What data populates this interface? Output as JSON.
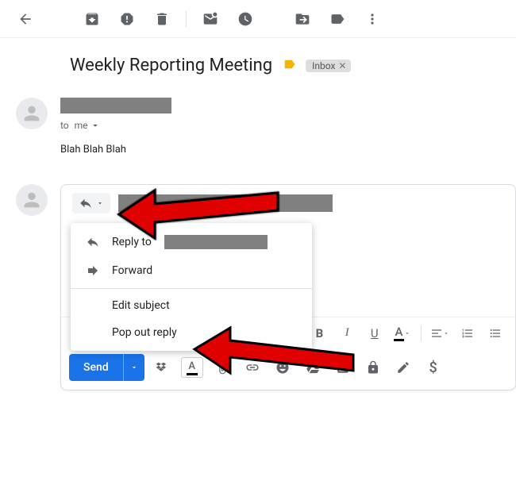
{
  "toolbar": {
    "icons": [
      "back",
      "archive",
      "spam",
      "delete",
      "unread",
      "snooze",
      "move",
      "label",
      "more"
    ]
  },
  "email": {
    "subject": "Weekly Reporting Meeting",
    "label_chip": "Inbox",
    "to_prefix": "to",
    "to_value": "me",
    "body_text": "Blah Blah Blah"
  },
  "reply": {
    "button_hint": "Reply",
    "menu": {
      "reply_to": "Reply to",
      "forward": "Forward",
      "edit_subject": "Edit subject",
      "pop_out": "Pop out reply"
    }
  },
  "format": {
    "bold": "B",
    "italic": "I",
    "underline": "U",
    "textcolor": "A",
    "align": "≡",
    "numlist": "1≡",
    "bulletlist": "•≡"
  },
  "send_bar": {
    "send": "Send",
    "icons": [
      "dropbox",
      "format",
      "attach",
      "link",
      "emoji",
      "drive",
      "photo",
      "lock",
      "pen",
      "dollar"
    ]
  }
}
